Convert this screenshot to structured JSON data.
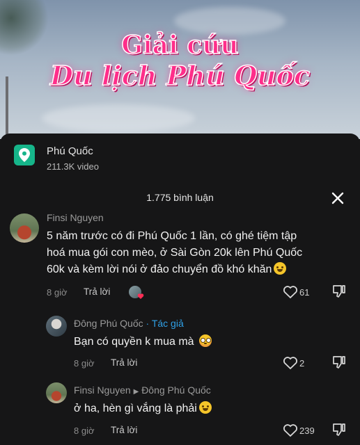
{
  "video": {
    "title_line1": "Giải cứu",
    "title_line2": "Du lịch Phú Quốc"
  },
  "location": {
    "icon": "location-pin-icon",
    "name": "Phú Quốc",
    "video_count": "211.3K video"
  },
  "comments_header": {
    "count_label": "1.775 bình luận",
    "close_icon": "close-icon"
  },
  "comments": [
    {
      "user": "Finsi Nguyen",
      "text_line1": "5 năm trước có đi Phú Quốc 1 lần, có ghé tiệm tập",
      "text_line2": "hoá mua gói con mèo, ở Sài Gòn 20k lên Phú Quốc",
      "text_line3": "60k và kèm lời nói ở đảo chuyển đồ khó khăn",
      "time": "8 giờ",
      "reply_label": "Trả lời",
      "likes": "61"
    },
    {
      "user": "Đông Phú Quốc",
      "badge": "· Tác giả",
      "text": "Bạn có quyền k mua mà",
      "time": "8 giờ",
      "reply_label": "Trả lời",
      "likes": "2"
    },
    {
      "user": "Finsi Nguyen",
      "reply_to": "Đông Phú Quốc",
      "text": "ở ha, hèn gì vắng là phải",
      "time": "8 giờ",
      "reply_label": "Trả lời",
      "likes": "239"
    }
  ],
  "colors": {
    "sheet_bg": "#161617",
    "author_badge": "#2fa0e6",
    "location_badge": "#16b58a",
    "title_pink": "#ff2e8a"
  }
}
